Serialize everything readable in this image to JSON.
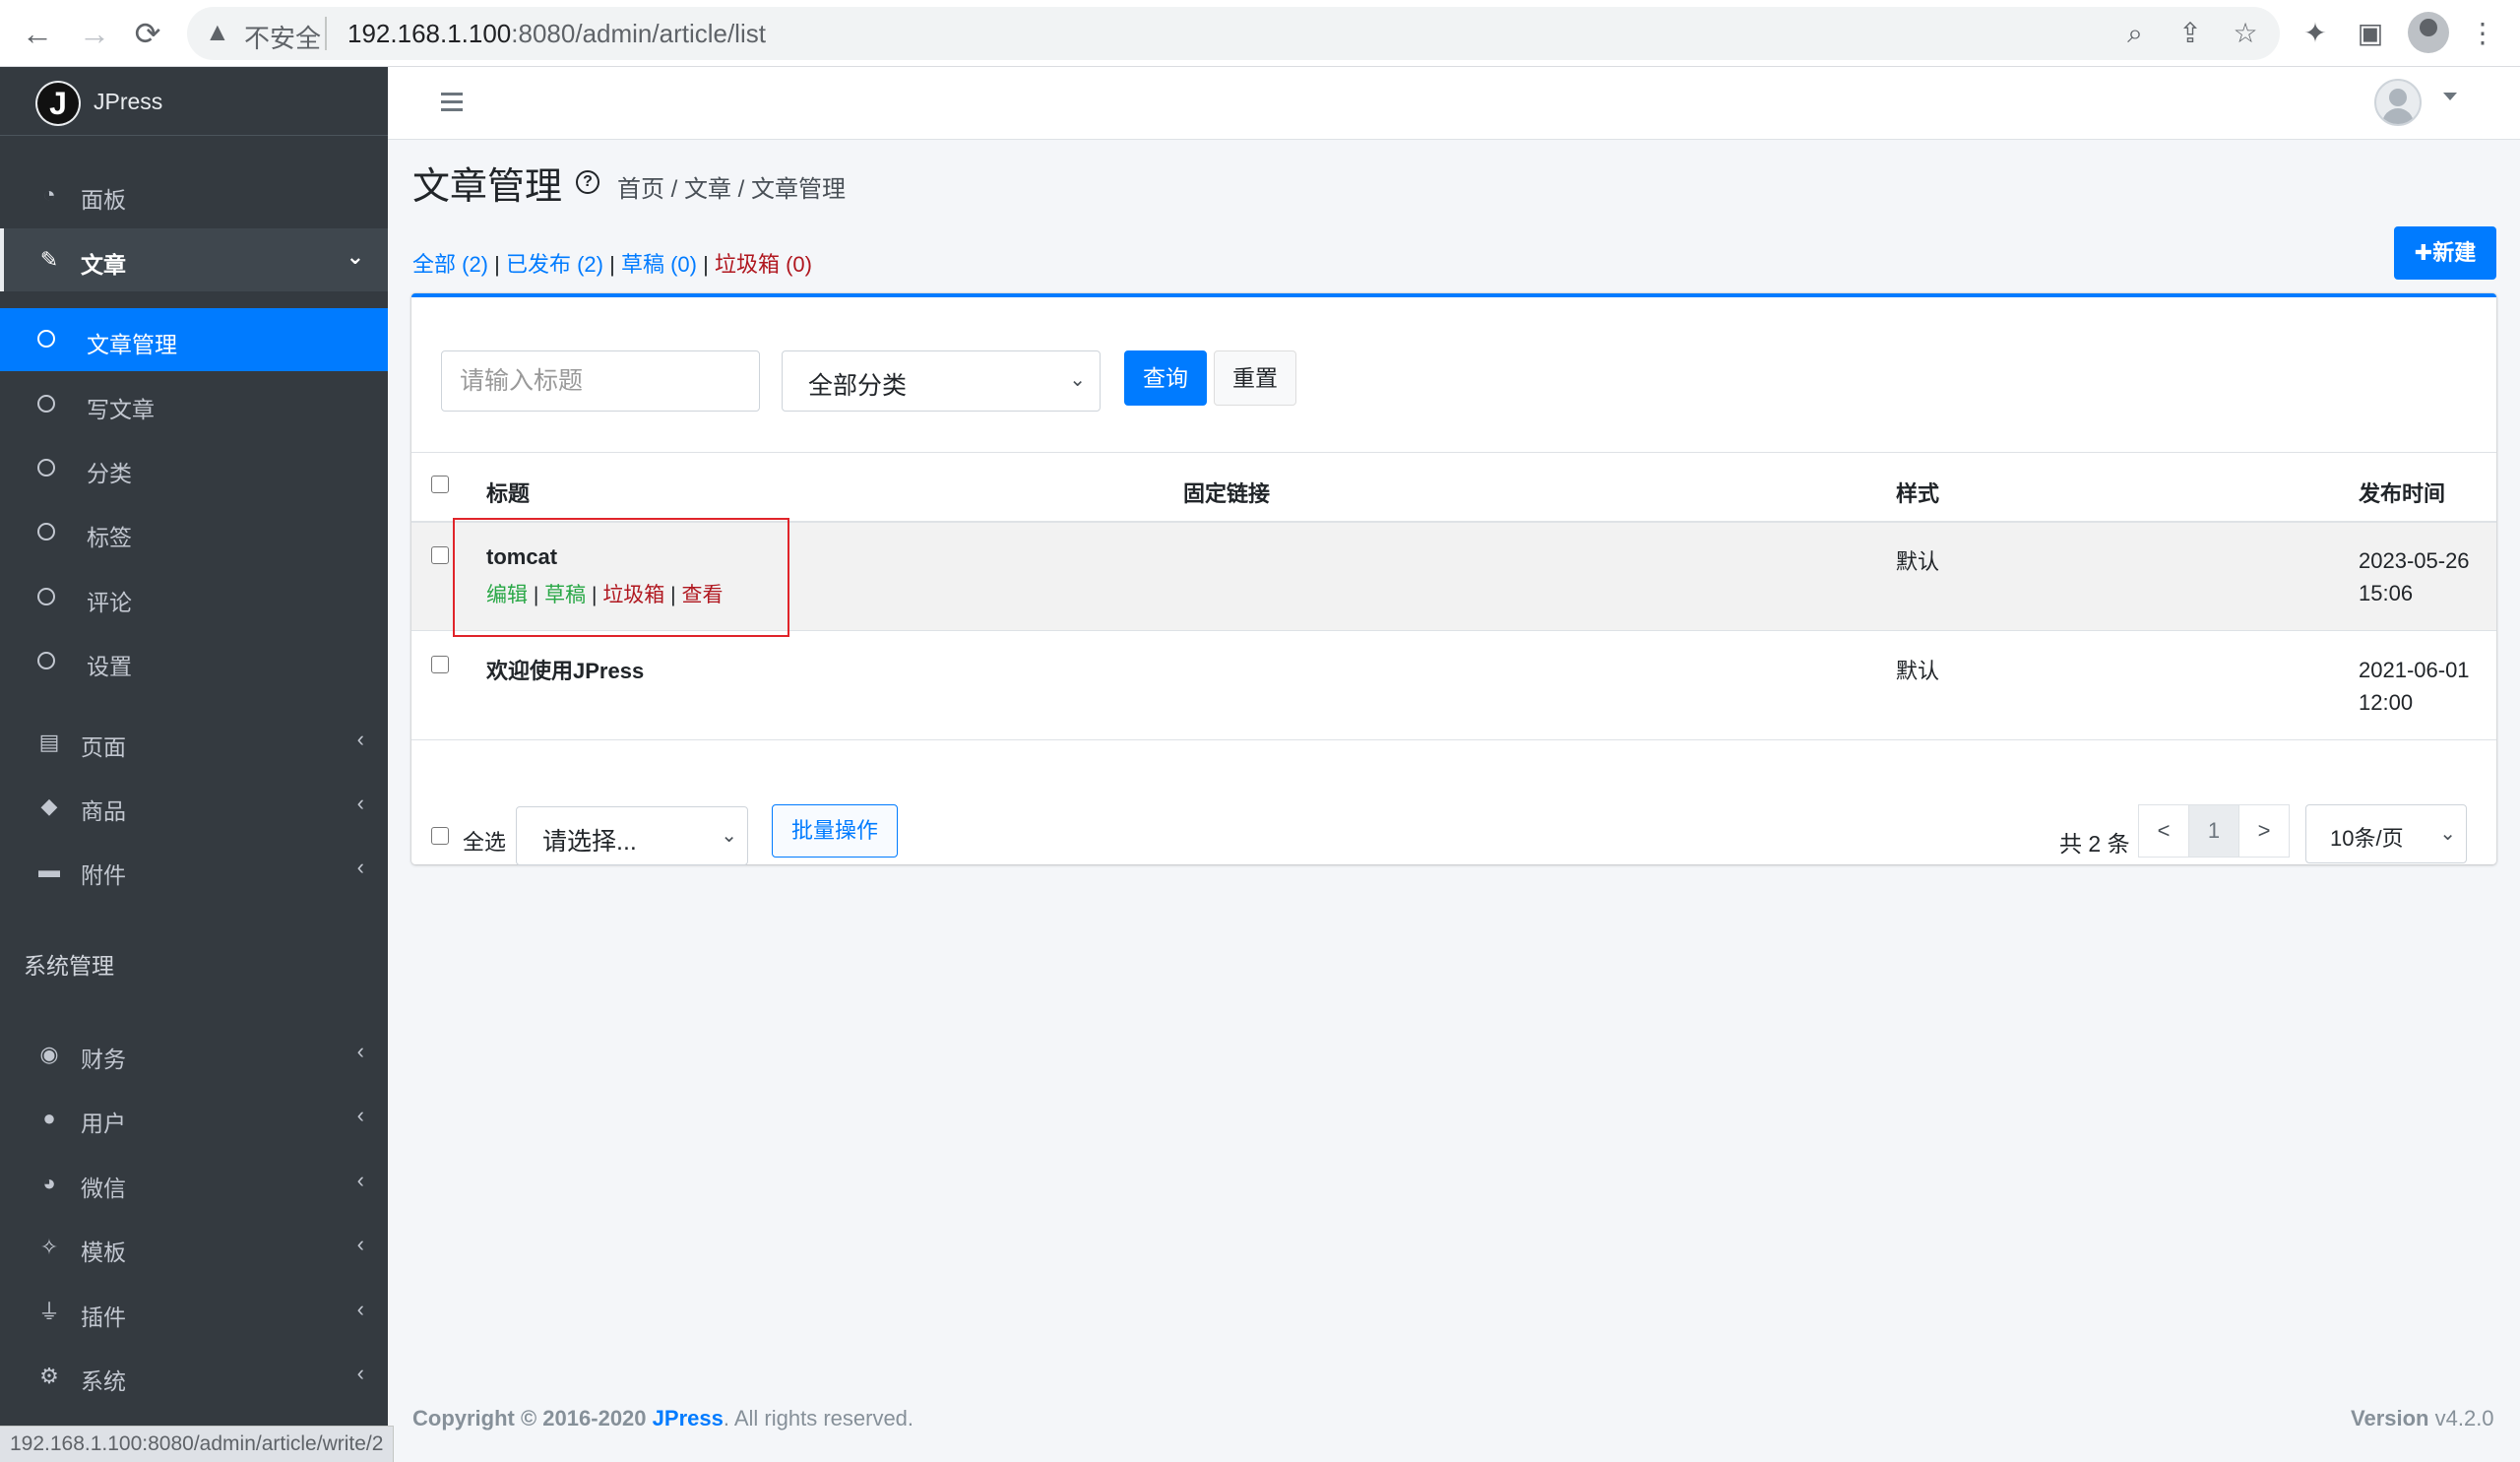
{
  "browser": {
    "back_icon": "←",
    "forward_icon": "→",
    "reload_icon": "⟳",
    "insecure_label": "不安全",
    "url_host": "192.168.1.100",
    "url_rest": ":8080/admin/article/list"
  },
  "sidebar": {
    "brand": "JPress",
    "dashboard": "面板",
    "article": "文章",
    "article_sub": [
      "文章管理",
      "写文章",
      "分类",
      "标签",
      "评论",
      "设置"
    ],
    "page": "页面",
    "product": "商品",
    "attachment": "附件",
    "system_header": "系统管理",
    "finance": "财务",
    "user": "用户",
    "wechat": "微信",
    "template": "模板",
    "plugin": "插件",
    "system": "系统"
  },
  "header": {
    "title": "文章管理",
    "breadcrumb": "首页 / 文章 / 文章管理"
  },
  "filters": {
    "all": "全部 (2)",
    "published": "已发布 (2)",
    "draft": "草稿 (0)",
    "trash": "垃圾箱 (0)",
    "sep": "|"
  },
  "new_button": "✚新建",
  "search": {
    "placeholder": "请输入标题",
    "category": "全部分类",
    "query": "查询",
    "reset": "重置"
  },
  "table": {
    "columns": [
      "标题",
      "固定链接",
      "样式",
      "发布时间"
    ],
    "rows": [
      {
        "title": "tomcat",
        "style": "默认",
        "date": "2023-05-26",
        "time": "15:06",
        "actions": {
          "edit": "编辑",
          "draft": "草稿",
          "trash": "垃圾箱",
          "view": "查看"
        }
      },
      {
        "title": "欢迎使用JPress",
        "style": "默认",
        "date": "2021-06-01",
        "time": "12:00"
      }
    ]
  },
  "footer_bar": {
    "select_all": "全选",
    "batch_placeholder": "请选择...",
    "batch_button": "批量操作",
    "total": "共 2 条",
    "prev": "<",
    "page": "1",
    "next": ">",
    "page_size": "10条/页"
  },
  "footer": {
    "copyright_prefix": "Copyright © 2016-2020",
    "brand": "JPress",
    "rights": ". All rights reserved.",
    "version_label": "Version",
    "version_value": "v4.2.0"
  },
  "status_url": "192.168.1.100:8080/admin/article/write/2",
  "colors": {
    "primary": "#007bff",
    "sidebar_bg": "#343a40",
    "trash_red": "#b0171f",
    "edit_green": "#28a745",
    "highlight_red": "#e0242a"
  }
}
